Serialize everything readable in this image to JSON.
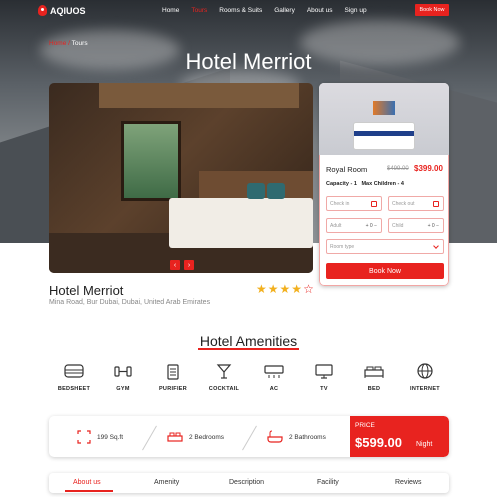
{
  "nav": {
    "logo": "AQIUOS",
    "items": [
      {
        "label": "Home",
        "active": false
      },
      {
        "label": "Tours",
        "active": true
      },
      {
        "label": "Rooms & Suits",
        "active": false
      },
      {
        "label": "Gallery",
        "active": false
      },
      {
        "label": "About us",
        "active": false
      },
      {
        "label": "Sign up",
        "active": false
      }
    ],
    "book_label": "Book Now"
  },
  "breadcrumb": {
    "home": "Home",
    "sep": "/",
    "current": "Tours"
  },
  "page_title": "Hotel Merriot",
  "booking": {
    "room": "Royal Room",
    "old_price": "$499.00",
    "new_price": "$399.00",
    "capacity": "Capacity - 1",
    "max_children": "Max Children - 4",
    "checkin_placeholder": "Check in",
    "checkout_placeholder": "Check out",
    "adult_label": "Adult",
    "adult_value": "0",
    "child_label": "Child",
    "child_value": "0",
    "room_type_placeholder": "Room type",
    "submit": "Book Now"
  },
  "hotel": {
    "name": "Hotel Merriot",
    "address": "Mina Road, Bur Dubai, Dubai, United Arab Emirates",
    "rating": 4,
    "rating_max": 5
  },
  "amenities": {
    "title": "Hotel Amenities",
    "items": [
      {
        "label": "BEDSHEET",
        "icon": "bedsheet-icon"
      },
      {
        "label": "GYM",
        "icon": "gym-icon"
      },
      {
        "label": "PURIFIER",
        "icon": "purifier-icon"
      },
      {
        "label": "COCKTAIL",
        "icon": "cocktail-icon"
      },
      {
        "label": "AC",
        "icon": "ac-icon"
      },
      {
        "label": "TV",
        "icon": "tv-icon"
      },
      {
        "label": "BED",
        "icon": "bed-icon"
      },
      {
        "label": "INTERNET",
        "icon": "internet-icon"
      }
    ]
  },
  "info": {
    "area": "199 Sq.ft",
    "bedrooms": "2 Bedrooms",
    "bathrooms": "2 Bathrooms",
    "price_label": "PRICE",
    "price": "$599.00",
    "price_unit": "Night"
  },
  "tabs": [
    {
      "label": "About us",
      "active": true
    },
    {
      "label": "Amenity",
      "active": false
    },
    {
      "label": "Description",
      "active": false
    },
    {
      "label": "Facility",
      "active": false
    },
    {
      "label": "Reviews",
      "active": false
    }
  ],
  "colors": {
    "accent": "#e8231f",
    "star": "#f2b01e"
  }
}
